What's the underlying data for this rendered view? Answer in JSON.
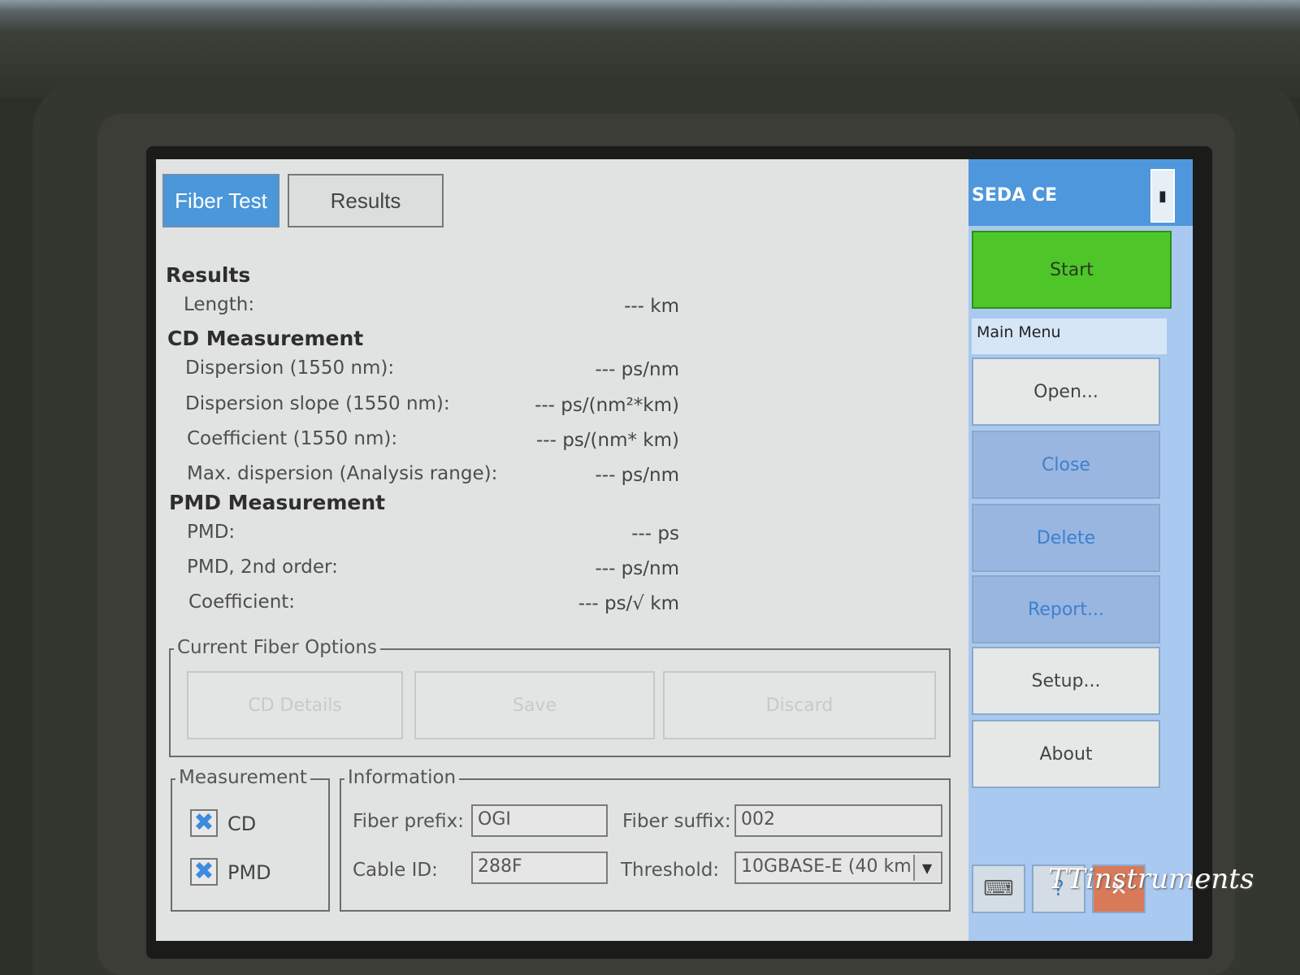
{
  "tabs": {
    "active": "Fiber Test",
    "inactive": "Results"
  },
  "results": {
    "heading": "Results",
    "length": {
      "label": "Length:",
      "value": "--- km"
    }
  },
  "cd": {
    "heading": "CD Measurement",
    "rows": [
      {
        "label": "Dispersion (1550 nm):",
        "value": "--- ps/nm"
      },
      {
        "label": "Dispersion slope (1550 nm):",
        "value": "--- ps/(nm²*km)"
      },
      {
        "label": "Coefficient (1550 nm):",
        "value": "--- ps/(nm* km)"
      },
      {
        "label": "Max. dispersion (Analysis range):",
        "value": "--- ps/nm"
      }
    ]
  },
  "pmd": {
    "heading": "PMD Measurement",
    "rows": [
      {
        "label": "PMD:",
        "value": "--- ps"
      },
      {
        "label": "PMD, 2nd order:",
        "value": "--- ps/nm"
      },
      {
        "label": "Coefficient:",
        "value": "--- ps/√ km"
      }
    ]
  },
  "fiber_options": {
    "legend": "Current Fiber Options",
    "buttons": [
      "CD Details",
      "Save",
      "Discard"
    ]
  },
  "measurement": {
    "legend": "Measurement",
    "cd_label": "CD",
    "cd_checked": true,
    "pmd_label": "PMD",
    "pmd_checked": true
  },
  "information": {
    "legend": "Information",
    "fiber_prefix_label": "Fiber prefix:",
    "fiber_prefix_value": "OGI",
    "fiber_suffix_label": "Fiber suffix:",
    "fiber_suffix_value": "002",
    "cable_id_label": "Cable ID:",
    "cable_id_value": "288F",
    "threshold_label": "Threshold:",
    "threshold_value": "10GBASE-E (40 km"
  },
  "sidebar": {
    "brand": "SEDA CE",
    "start": "Start",
    "menu_header": "Main Menu",
    "items": [
      {
        "label": "Open...",
        "enabled": true
      },
      {
        "label": "Close",
        "enabled": false
      },
      {
        "label": "Delete",
        "enabled": false
      },
      {
        "label": "Report...",
        "enabled": false
      },
      {
        "label": "Setup...",
        "enabled": true
      },
      {
        "label": "About",
        "enabled": true
      }
    ]
  },
  "icons": {
    "battery": "battery-icon",
    "keyboard": "keyboard-icon",
    "help": "help-icon",
    "exit": "exit-icon",
    "dropdown": "chevron-down-icon",
    "checkbox": "checkbox-checked-icon"
  },
  "colors": {
    "tab_active": "#4a97da",
    "start_green": "#4ec62a",
    "sidebar_bg": "#a9c9f0",
    "disabled_text": "#3f7fcf"
  },
  "watermark": "TTinstruments"
}
